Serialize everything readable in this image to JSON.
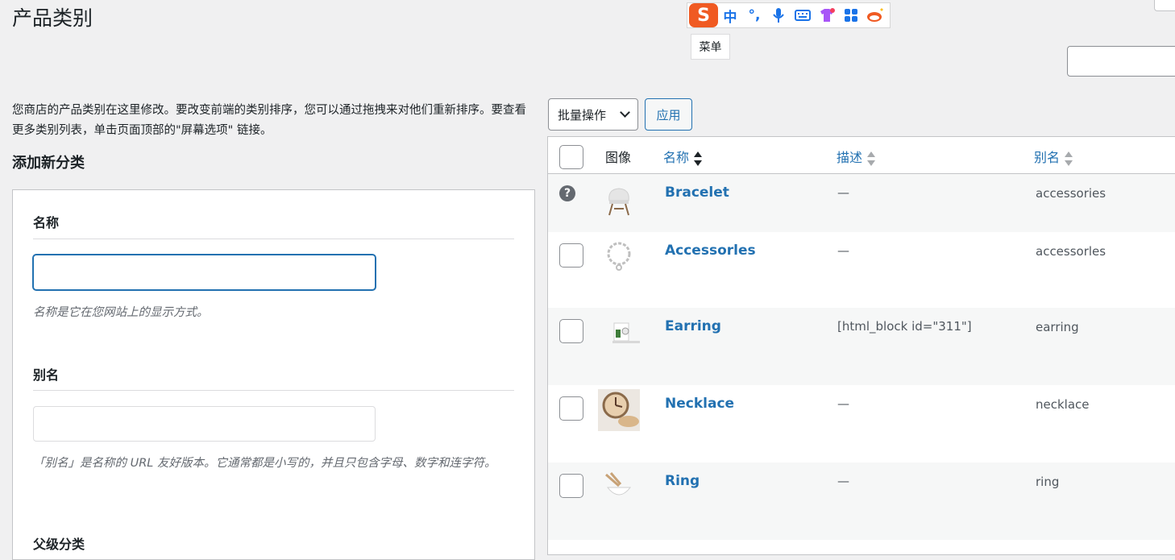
{
  "page": {
    "title": "产品类别"
  },
  "ime": {
    "logo": "S",
    "items": [
      "中",
      "°,",
      "mic-icon",
      "keyboard-icon",
      "shirt-icon",
      "grid-icon",
      "mascot-icon"
    ],
    "lang_label": "中",
    "punct_label": "°,",
    "tooltip": "菜单"
  },
  "intro": {
    "description": "您商店的产品类别在这里修改。要改变前端的类别排序，您可以通过拖拽来对他们重新排序。要查看更多类别列表，单击页面顶部的\"屏幕选项\" 链接。",
    "add_title": "添加新分类"
  },
  "form": {
    "name_label": "名称",
    "name_value": "",
    "name_help": "名称是它在您网站上的显示方式。",
    "slug_label": "别名",
    "slug_value": "",
    "slug_help": "「别名」是名称的 URL 友好版本。它通常都是小写的，并且只包含字母、数字和连字符。",
    "parent_label": "父级分类"
  },
  "toolbar": {
    "bulk_action": "批量操作",
    "apply": "应用"
  },
  "table": {
    "columns": {
      "image": "图像",
      "name": "名称",
      "description": "描述",
      "slug": "别名"
    },
    "rows": [
      {
        "name": "Bracelet",
        "description": "—",
        "slug": "accessories",
        "thumb": "chair"
      },
      {
        "name": "Accessorles",
        "description": "—",
        "slug": "accessorles",
        "thumb": "chain"
      },
      {
        "name": "Earring",
        "description": "[html_block id=\"311\"]",
        "slug": "earring",
        "thumb": "shelf"
      },
      {
        "name": "Necklace",
        "description": "—",
        "slug": "necklace",
        "thumb": "clock"
      },
      {
        "name": "Ring",
        "description": "—",
        "slug": "ring",
        "thumb": "bowl"
      }
    ]
  },
  "colors": {
    "link": "#2271b1",
    "accent_ime": "#f05a22",
    "background": "#f0f0f1"
  }
}
